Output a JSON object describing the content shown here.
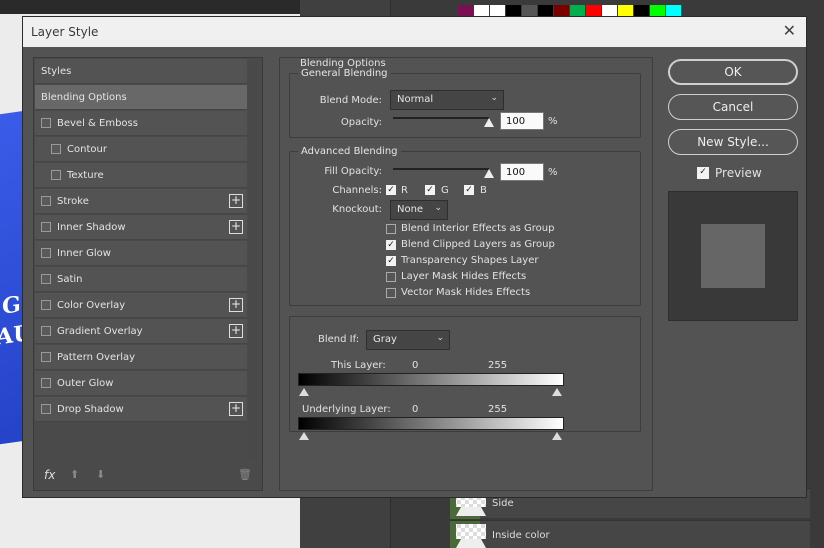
{
  "dialog": {
    "title": "Layer Style",
    "close_glyph": "✕"
  },
  "background": {
    "doc_text": [
      "G",
      "AUI"
    ],
    "swatch_colors": [
      "#7a1050",
      "#ffffff",
      "#ffffff",
      "#000000",
      "#555555",
      "#000000",
      "#7a0000",
      "#00b050",
      "#ff0000",
      "#ffffff",
      "#ffff00",
      "#000000",
      "#00ff00",
      "#00ffff"
    ],
    "layers": [
      {
        "label": "Side"
      },
      {
        "label": "Inside color"
      }
    ]
  },
  "styles": {
    "header": "Styles",
    "items": [
      {
        "label": "Blending Options",
        "selected": true,
        "has_checkbox": false,
        "has_plus": false
      },
      {
        "label": "Bevel & Emboss",
        "has_checkbox": true,
        "has_plus": false
      },
      {
        "label": "Contour",
        "has_checkbox": true,
        "indent": true
      },
      {
        "label": "Texture",
        "has_checkbox": true,
        "indent": true
      },
      {
        "label": "Stroke",
        "has_checkbox": true,
        "has_plus": true
      },
      {
        "label": "Inner Shadow",
        "has_checkbox": true,
        "has_plus": true
      },
      {
        "label": "Inner Glow",
        "has_checkbox": true
      },
      {
        "label": "Satin",
        "has_checkbox": true
      },
      {
        "label": "Color Overlay",
        "has_checkbox": true,
        "has_plus": true
      },
      {
        "label": "Gradient Overlay",
        "has_checkbox": true,
        "has_plus": true
      },
      {
        "label": "Pattern Overlay",
        "has_checkbox": true
      },
      {
        "label": "Outer Glow",
        "has_checkbox": true
      },
      {
        "label": "Drop Shadow",
        "has_checkbox": true,
        "has_plus": true
      }
    ],
    "footer": {
      "fx": "fx",
      "up": "⬆",
      "down": "⬇",
      "trash": "🗑"
    }
  },
  "blending": {
    "section_title": "Blending Options",
    "general": {
      "legend": "General Blending",
      "blend_mode_label": "Blend Mode:",
      "blend_mode_value": "Normal",
      "opacity_label": "Opacity:",
      "opacity_value": "100",
      "opacity_unit": "%",
      "opacity_fraction": 1.0
    },
    "advanced": {
      "legend": "Advanced Blending",
      "fill_opacity_label": "Fill Opacity:",
      "fill_opacity_value": "100",
      "fill_opacity_unit": "%",
      "fill_opacity_fraction": 1.0,
      "channels_label": "Channels:",
      "channels": [
        {
          "label": "R",
          "checked": true
        },
        {
          "label": "G",
          "checked": true
        },
        {
          "label": "B",
          "checked": true
        }
      ],
      "knockout_label": "Knockout:",
      "knockout_value": "None",
      "options": [
        {
          "label": "Blend Interior Effects as Group",
          "checked": false
        },
        {
          "label": "Blend Clipped Layers as Group",
          "checked": true
        },
        {
          "label": "Transparency Shapes Layer",
          "checked": true
        },
        {
          "label": "Layer Mask Hides Effects",
          "checked": false
        },
        {
          "label": "Vector Mask Hides Effects",
          "checked": false
        }
      ]
    },
    "blend_if": {
      "label": "Blend If:",
      "value": "Gray",
      "this_layer_label": "This Layer:",
      "this_layer_low": "0",
      "this_layer_high": "255",
      "underlying_label": "Underlying Layer:",
      "underlying_low": "0",
      "underlying_high": "255"
    }
  },
  "buttons": {
    "ok": "OK",
    "cancel": "Cancel",
    "new_style": "New Style...",
    "preview_label": "Preview",
    "preview_checked": true
  }
}
